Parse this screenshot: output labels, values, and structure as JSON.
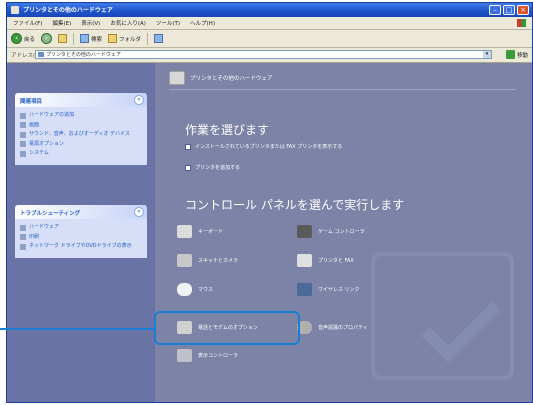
{
  "window": {
    "title": "プリンタとその他のハードウェア"
  },
  "menu": [
    "ファイル(F)",
    "編集(E)",
    "表示(V)",
    "お気に入り(A)",
    "ツール(T)",
    "ヘルプ(H)"
  ],
  "toolbar": {
    "back": "戻る",
    "search": "検索",
    "folders": "フォルダ"
  },
  "address": {
    "label": "アドレス(D)",
    "value": "プリンタとその他のハードウェア",
    "go": "移動"
  },
  "left": {
    "panel1": {
      "title": "関連項目",
      "items": [
        "ハードウェアの追加",
        "画面",
        "サウンド、音声、およびオーディオ デバイス",
        "電源オプション",
        "システム"
      ]
    },
    "panel2": {
      "title": "トラブルシューティング",
      "items": [
        "ハードウェア",
        "印刷",
        "ネットワーク ドライブやDVDドライブの表示"
      ]
    }
  },
  "main": {
    "header": "プリンタとその他のハードウェア",
    "task_title": "作業を選びます",
    "tasks": [
      "インストールされているプリンタまたは FAX プリンタを表示する",
      "プリンタを追加する"
    ],
    "cp_title": "コントロール パネルを選んで実行します",
    "categories": [
      "キーボード",
      "ゲーム コントローラ",
      "スキャナとカメラ",
      "プリンタと FAX",
      "マウス",
      "ワイヤレス リンク",
      "電話とモデムのオプション",
      "音声認識のプロパティ",
      "表示コントローラ"
    ]
  },
  "colors": {
    "titlebar": "#1d53c8",
    "main_background": "#7c83a6",
    "left_pane": "#6a73a6",
    "panel_body": "#d6dff7",
    "link": "#215dc6",
    "highlight": "#1a7fd4"
  },
  "icons": {
    "back": "back-arrow-icon",
    "forward": "forward-arrow-icon",
    "search": "search-icon",
    "folders": "folders-icon",
    "go": "go-arrow-icon"
  }
}
